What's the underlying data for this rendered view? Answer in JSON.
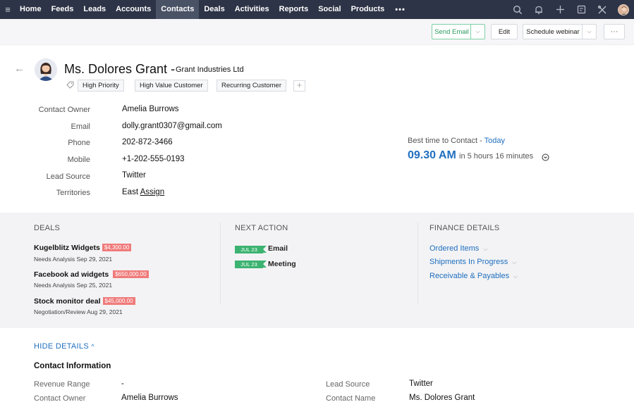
{
  "nav": {
    "items": [
      "Home",
      "Feeds",
      "Leads",
      "Accounts",
      "Contacts",
      "Deals",
      "Activities",
      "Reports",
      "Social",
      "Products"
    ],
    "active": "Contacts",
    "more": "•••"
  },
  "toolbar": {
    "send_email": "Send Email",
    "edit": "Edit",
    "schedule_webinar": "Schedule webinar",
    "more": "···"
  },
  "record": {
    "name": "Ms. Dolores Grant",
    "separator": "-",
    "company": "Grant Industries Ltd",
    "tags": [
      "High Priority",
      "High Value Customer",
      "Recurring Customer"
    ],
    "add_tag": "+"
  },
  "fields": [
    {
      "label": "Contact Owner",
      "value": "Amelia Burrows"
    },
    {
      "label": "Email",
      "value": "dolly.grant0307@gmail.com"
    },
    {
      "label": "Phone",
      "value": "202-872-3466"
    },
    {
      "label": "Mobile",
      "value": "+1-202-555-0193"
    },
    {
      "label": "Lead Source",
      "value": "Twitter"
    },
    {
      "label": "Territories",
      "value": "East",
      "link": "Assign"
    }
  ],
  "best_time": {
    "label": "Best time to Contact - ",
    "day": "Today",
    "time": "09.30 AM",
    "in": "in 5 hours 16 minutes"
  },
  "deals": {
    "title": "DEALS",
    "items": [
      {
        "name": "Kugelblitz Widgets",
        "amount": "$4,300.00",
        "stage": "Needs Analysis Sep 29, 2021"
      },
      {
        "name": "Facebook ad widgets",
        "amount": "$650,000.00",
        "stage": "Needs Analysis Sep 25, 2021"
      },
      {
        "name": "Stock monitor deal",
        "amount": "$45,000.00",
        "stage": "Negotiation/Review Aug 29, 2021"
      }
    ]
  },
  "next_action": {
    "title": "NEXT ACTION",
    "items": [
      {
        "date": "JUL 23",
        "label": "Email"
      },
      {
        "date": "JUL 23",
        "label": "Meeting"
      }
    ]
  },
  "finance": {
    "title": "FINANCE DETAILS",
    "links": [
      "Ordered Items",
      "Shipments In Progress",
      "Receivable & Payables"
    ]
  },
  "details": {
    "toggle": "HIDE DETAILS",
    "section_title": "Contact Information",
    "left": [
      {
        "label": "Revenue Range",
        "value": "-"
      },
      {
        "label": "Contact Owner",
        "value": "Amelia Burrows"
      }
    ],
    "right": [
      {
        "label": "Lead Source",
        "value": "Twitter"
      },
      {
        "label": "Contact Name",
        "value": "Ms. Dolores Grant"
      }
    ]
  },
  "colors": {
    "nav_bg": "#2d3447",
    "accent_blue": "#1f6fbf",
    "badge_green": "#3cb371",
    "amount_red": "#f07a7a"
  }
}
